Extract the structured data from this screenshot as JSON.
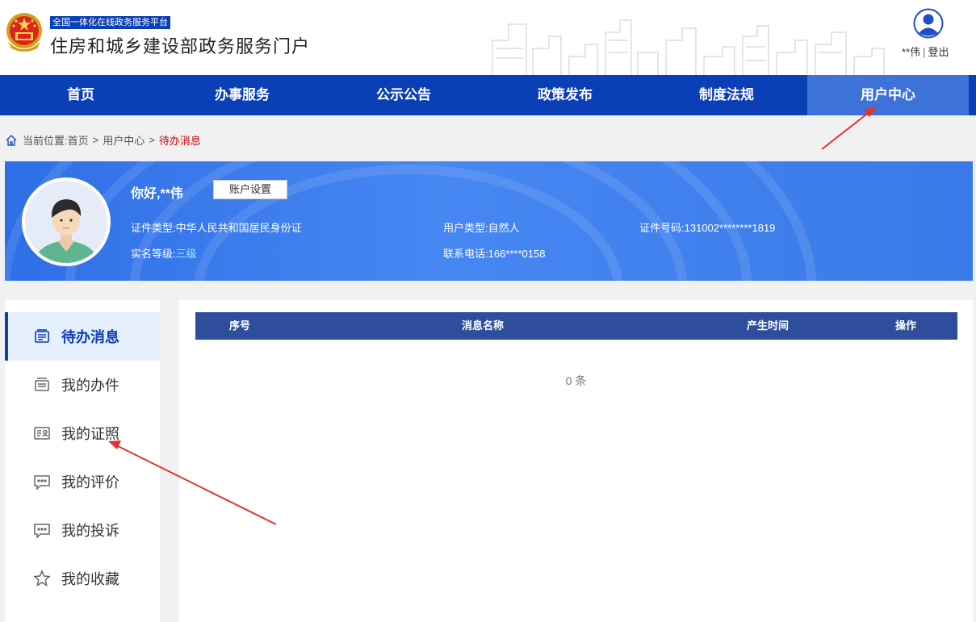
{
  "header": {
    "platform_tag": "全国一体化在线政务服务平台",
    "site_title": "住房和城乡建设部政务服务门户",
    "username": "**伟",
    "separator": "|",
    "logout_label": "登出"
  },
  "nav": {
    "items": [
      {
        "label": "首页"
      },
      {
        "label": "办事服务"
      },
      {
        "label": "公示公告"
      },
      {
        "label": "政策发布"
      },
      {
        "label": "制度法规"
      },
      {
        "label": "用户中心"
      }
    ],
    "active_index": 5
  },
  "breadcrumb": {
    "prefix": "当前位置:",
    "items": [
      "首页",
      "用户中心"
    ],
    "separator": ">",
    "current": "待办消息"
  },
  "profile": {
    "greeting": "你好,**伟",
    "account_settings_label": "账户设置",
    "id_type_label": "证件类型:",
    "id_type_value": "中华人民共和国居民身份证",
    "user_type_label": "用户类型:",
    "user_type_value": "自然人",
    "id_number_label": "证件号码:",
    "id_number_value": "131002********1819",
    "level_label": "实名等级:",
    "level_value": "三级",
    "phone_label": "联系电话:",
    "phone_value": "166****0158"
  },
  "sidebar": {
    "items": [
      {
        "label": "待办消息",
        "icon": "inbox-icon"
      },
      {
        "label": "我的办件",
        "icon": "tray-icon"
      },
      {
        "label": "我的证照",
        "icon": "id-card-icon"
      },
      {
        "label": "我的评价",
        "icon": "comment-icon"
      },
      {
        "label": "我的投诉",
        "icon": "comment-icon"
      },
      {
        "label": "我的收藏",
        "icon": "star-icon"
      }
    ],
    "active_index": 0
  },
  "table": {
    "columns": [
      "序号",
      "消息名称",
      "产生时间",
      "操作"
    ],
    "rows": [],
    "empty_text": "0 条"
  },
  "colors": {
    "brand_blue": "#0b3fb6",
    "nav_active": "#3d72d8",
    "table_header": "#2e4e9c",
    "annotation_red": "#e8302a",
    "breadcrumb_current": "#cc0000"
  }
}
